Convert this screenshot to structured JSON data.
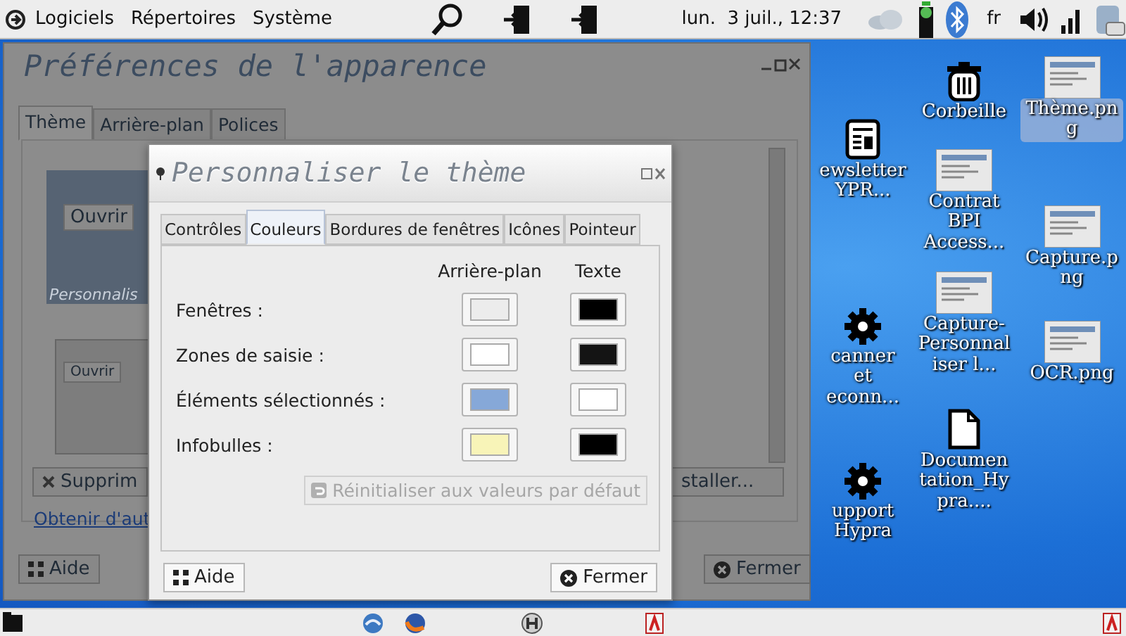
{
  "top_panel": {
    "menus": [
      "Logiciels",
      "Répertoires",
      "Système"
    ],
    "clock": "lun.  3 juil., 12:37",
    "keyboard_layout": "fr"
  },
  "background_window": {
    "title": "Préférences de l'apparence",
    "tabs": [
      {
        "label": "Thème",
        "selected": true
      },
      {
        "label": "Arrière-plan",
        "selected": false
      },
      {
        "label": "Polices",
        "selected": false
      }
    ],
    "preview_buttons": [
      "Ouvrir",
      "Ouvrir"
    ],
    "theme_caption": "Personnalis",
    "remove_button": "Supprim",
    "install_button": "staller...",
    "link": "Obtenir d'aut",
    "help_button": "Aide",
    "close_button": "Fermer"
  },
  "dialog": {
    "title": "Personnaliser le thème",
    "tabs": [
      {
        "label": "Contrôles",
        "selected": false
      },
      {
        "label": "Couleurs",
        "selected": true
      },
      {
        "label": "Bordures de fenêtres",
        "selected": false
      },
      {
        "label": "Icônes",
        "selected": false
      },
      {
        "label": "Pointeur",
        "selected": false
      }
    ],
    "columns": [
      "Arrière-plan",
      "Texte"
    ],
    "rows": [
      {
        "label": "Fenêtres :",
        "swatches": [
          {
            "color": "#ececec"
          },
          {
            "color": "#000000"
          }
        ]
      },
      {
        "label": "Zones de saisie :",
        "swatches": [
          {
            "color": "#ffffff"
          },
          {
            "color": "#141414"
          }
        ]
      },
      {
        "label": "Éléments sélectionnés :",
        "swatches": [
          {
            "color": "#86a8d8"
          },
          {
            "color": "#ffffff"
          }
        ]
      },
      {
        "label": "Infobulles :",
        "swatches": [
          {
            "color": "#f8f4b8"
          },
          {
            "color": "#000000"
          }
        ]
      }
    ],
    "reset_button": {
      "label": "Réinitialiser aux valeurs par défaut",
      "disabled": true
    },
    "help_button": "Aide",
    "close_button": "Fermer"
  },
  "desktop_icons": [
    {
      "label": "Corbeille",
      "kind": "trash",
      "selected": false
    },
    {
      "label": "ewsletter YPR...",
      "kind": "newsletter",
      "selected": false
    },
    {
      "label": "Contrat BPI Access...",
      "kind": "thumbnail",
      "selected": false
    },
    {
      "label": "Thème.png",
      "kind": "thumbnail",
      "selected": true
    },
    {
      "label": "Capture.png",
      "kind": "thumbnail",
      "selected": false
    },
    {
      "label": "Capture-Personnaliser l...",
      "kind": "thumbnail",
      "selected": false
    },
    {
      "label": "OCR.png",
      "kind": "thumbnail",
      "selected": false
    },
    {
      "label": "canner et econn...",
      "kind": "gear",
      "selected": false
    },
    {
      "label": "Documentation_Hypra....",
      "kind": "file",
      "selected": false
    },
    {
      "label": "upport Hypra",
      "kind": "gear",
      "selected": false
    }
  ]
}
